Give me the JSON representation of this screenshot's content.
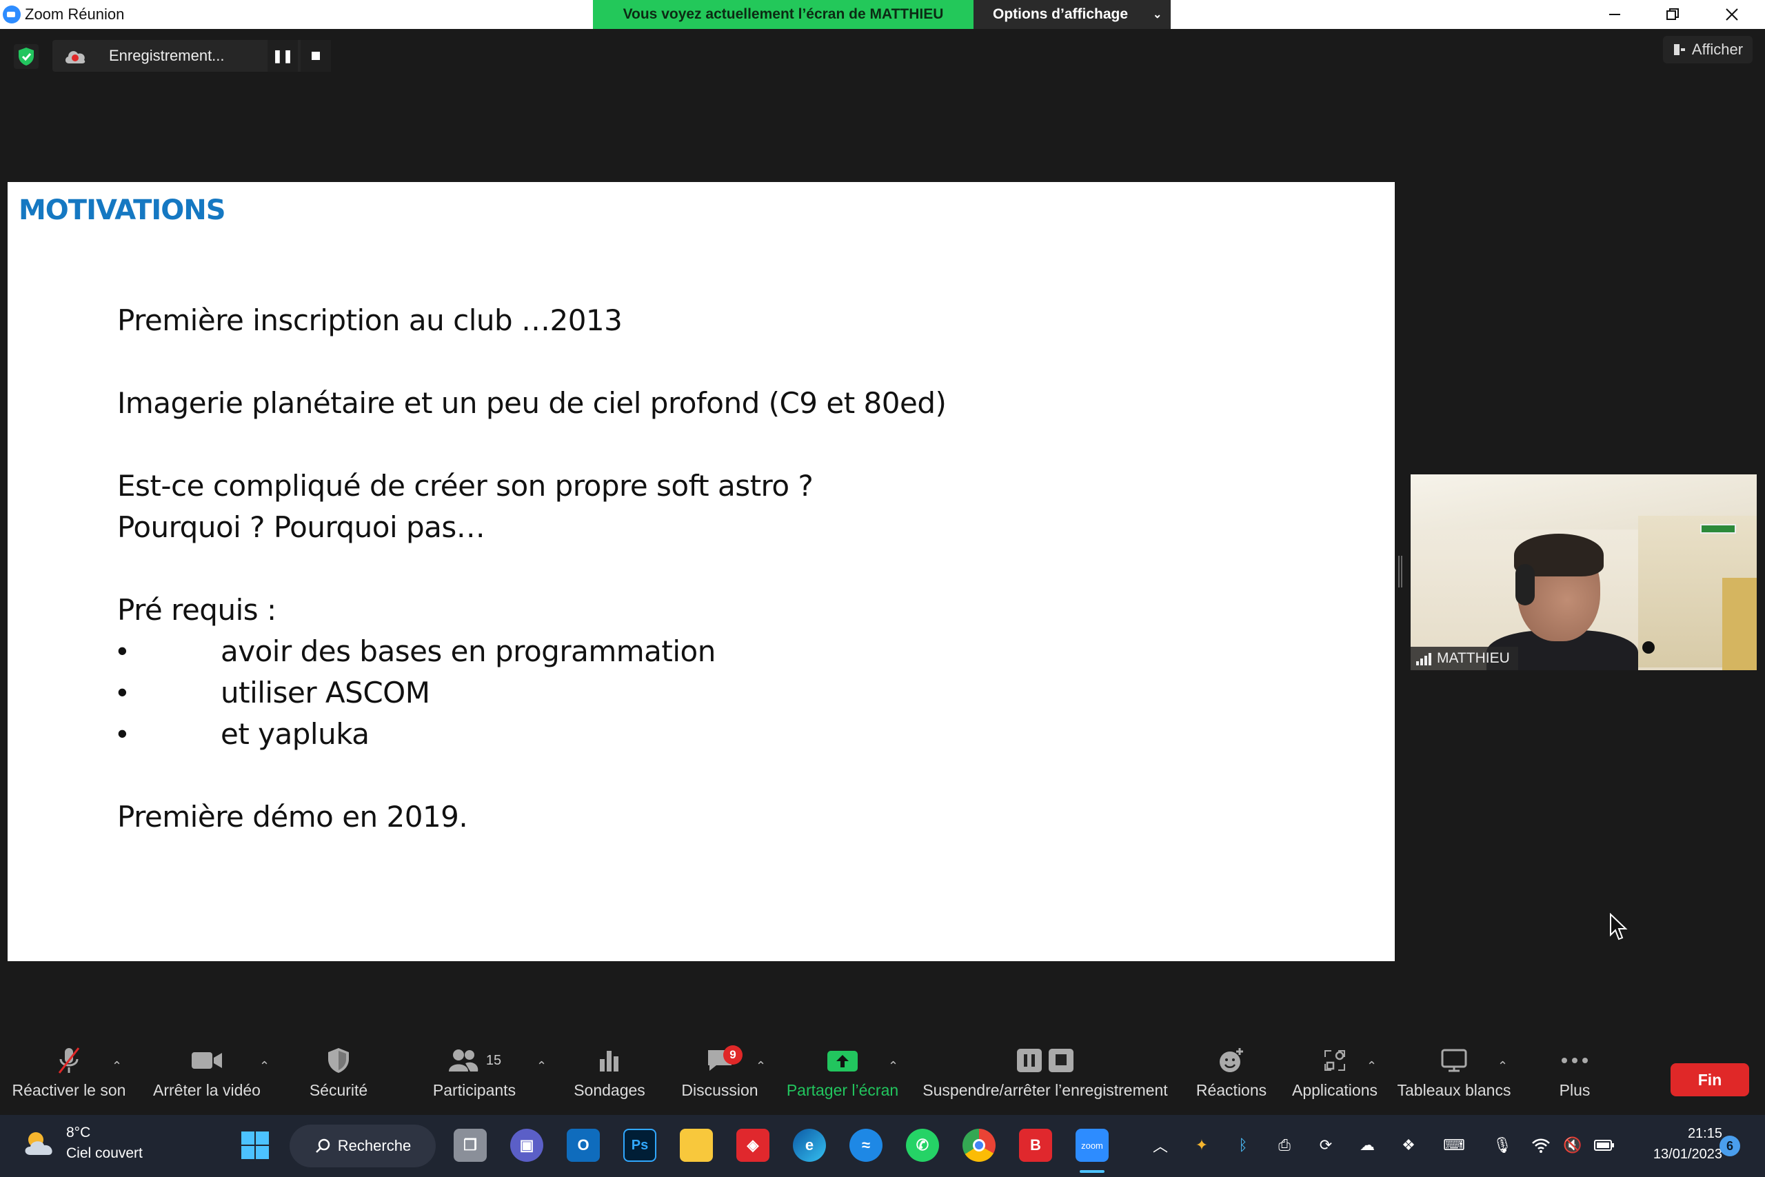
{
  "window": {
    "title": "Zoom Réunion",
    "share_banner": "Vous voyez actuellement l’écran de MATTHIEU",
    "view_options": "Options d’affichage"
  },
  "recording": {
    "label": "Enregistrement...",
    "afficher": "Afficher"
  },
  "slide": {
    "title": "MOTIVATIONS",
    "line1": "Première inscription au club …2013",
    "line2": "Imagerie planétaire et un peu de ciel profond (C9 et 80ed)",
    "line3": "Est-ce compliqué de créer son propre soft astro ?",
    "line4": "Pourquoi ? Pourquoi pas…",
    "line5": "Pré requis :",
    "bullets": [
      "avoir des bases en programmation",
      "utiliser ASCOM",
      "et yapluka"
    ],
    "bullet_char": "•",
    "line6": "Première démo en 2019."
  },
  "video": {
    "participant_name": "MATTHIEU"
  },
  "toolbar": {
    "unmute": "Réactiver le son",
    "stop_video": "Arrêter la vidéo",
    "security": "Sécurité",
    "participants": "Participants",
    "participants_count": "15",
    "polls": "Sondages",
    "chat": "Discussion",
    "chat_badge": "9",
    "share_screen": "Partager l’écran",
    "recording_control": "Suspendre/arrêter l’enregistrement",
    "reactions": "Réactions",
    "apps": "Applications",
    "whiteboards": "Tableaux blancs",
    "more": "Plus",
    "end": "Fin"
  },
  "taskbar": {
    "weather_temp": "8°C",
    "weather_desc": "Ciel couvert",
    "search": "Recherche",
    "time": "21:15",
    "date": "13/01/2023",
    "notifications": "6",
    "apps": [
      "task-view",
      "teams",
      "outlook",
      "photoshop",
      "file-explorer",
      "brave",
      "edge",
      "cloud-app",
      "whatsapp",
      "chrome",
      "bitdefender",
      "zoom"
    ]
  },
  "colors": {
    "banner_green": "#23c85a",
    "slide_title_blue": "#1578c2",
    "end_red": "#e02828",
    "share_green": "#22c55e"
  }
}
